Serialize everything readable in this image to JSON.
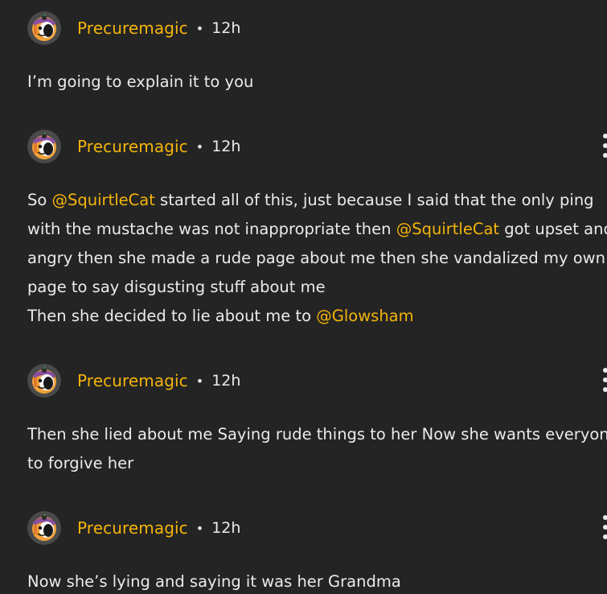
{
  "comments": [
    {
      "username": "Precuremagic",
      "separator": "•",
      "time": "12h",
      "lines": [
        [
          {
            "text": "I’m going to explain it to you"
          }
        ]
      ]
    },
    {
      "username": "Precuremagic",
      "separator": "•",
      "time": "12h",
      "lines": [
        [
          {
            "text": "So "
          },
          {
            "mention": "@SquirtleCat"
          },
          {
            "text": " started all of this, just because I said that the only ping"
          }
        ],
        [
          {
            "text": "with the mustache was not inappropriate then "
          },
          {
            "mention": "@SquirtleCat"
          },
          {
            "text": " got upset and"
          }
        ],
        [
          {
            "text": "angry then she made a rude page about me then she vandalized my own"
          }
        ],
        [
          {
            "text": "page to say disgusting stuff about me"
          }
        ],
        [
          {
            "text": "Then she decided to lie about me to "
          },
          {
            "mention": "@Glowsham"
          }
        ]
      ]
    },
    {
      "username": "Precuremagic",
      "separator": "•",
      "time": "12h",
      "lines": [
        [
          {
            "text": "Then she lied about me Saying rude things to her Now she wants everyone"
          }
        ],
        [
          {
            "text": "to forgive her"
          }
        ]
      ]
    },
    {
      "username": "Precuremagic",
      "separator": "•",
      "time": "12h",
      "lines": [
        [
          {
            "text": "Now she’s lying and saying it was her Grandma"
          }
        ]
      ]
    }
  ],
  "icons": {
    "avatar": "avatar-icon",
    "more": "more-vertical-icon"
  },
  "colors": {
    "background": "#242424",
    "username": "#f4b50a",
    "mention": "#f4b50a",
    "text": "#ebebeb"
  }
}
